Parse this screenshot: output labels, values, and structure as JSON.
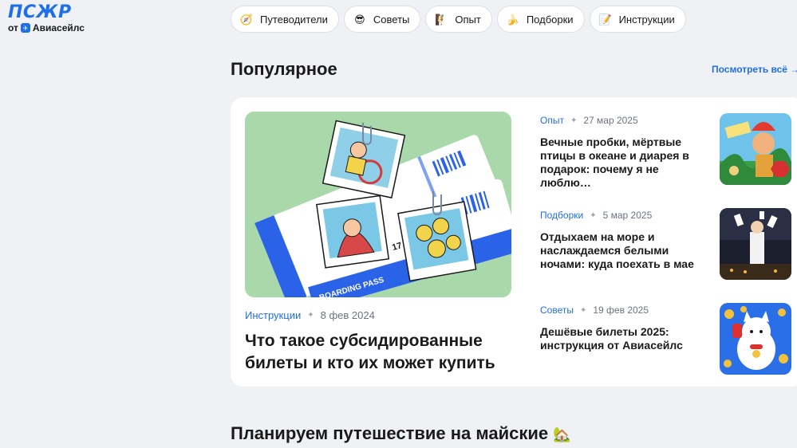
{
  "logo": {
    "main": "ПСЖР",
    "sub_prefix": "от",
    "sub_brand": "Авиасейлс",
    "brand_color": "#1f6fe8"
  },
  "tabs": [
    {
      "label": "Путеводители",
      "icon": "compass-icon",
      "glyph": "🧭"
    },
    {
      "label": "Советы",
      "icon": "sunglasses-face-icon",
      "glyph": "😎"
    },
    {
      "label": "Опыт",
      "icon": "climber-icon",
      "glyph": "🧗"
    },
    {
      "label": "Подборки",
      "icon": "banana-icon",
      "glyph": "🍌"
    },
    {
      "label": "Инструкции",
      "icon": "memo-icon",
      "glyph": "📝"
    }
  ],
  "popular": {
    "title": "Популярное",
    "see_all": "Посмотреть всё",
    "feature": {
      "category": "Инструкции",
      "date": "8 фев 2024",
      "title": "Что такое субсидированные билеты и кто их может купить",
      "image": "boarding-pass-illustration"
    },
    "items": [
      {
        "category": "Опыт",
        "date": "27 мар 2025",
        "title": "Вечные пробки, мёртвые птицы в океане и диарея в подарок: почему я не люблю…",
        "image": "bali-collage-thumbnail"
      },
      {
        "category": "Подборки",
        "date": "5 мар 2025",
        "title": "Отдыхаем на море и наслаждаемся белыми ночами: куда поехать в мае",
        "image": "white-nights-thumbnail"
      },
      {
        "category": "Советы",
        "date": "19 фев 2025",
        "title": "Дешёвые билеты 2025: инструкция от Авиасейлс",
        "image": "lucky-cat-thumbnail"
      }
    ]
  },
  "planning": {
    "title": "Планируем путешествие на майские",
    "emoji": "🏡"
  }
}
